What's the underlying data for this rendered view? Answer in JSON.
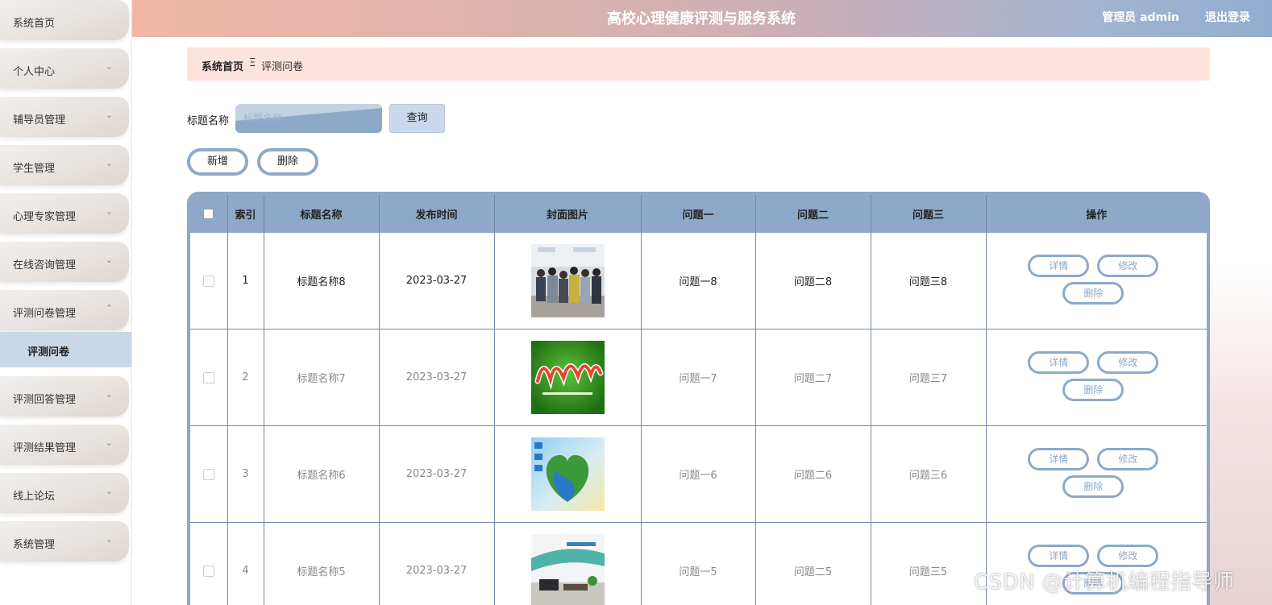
{
  "header": {
    "title": "高校心理健康评测与服务系统",
    "user": "管理员 admin",
    "logout": "退出登录"
  },
  "sidebar": {
    "items": [
      {
        "label": "系统首页"
      },
      {
        "label": "个人中心"
      },
      {
        "label": "辅导员管理"
      },
      {
        "label": "学生管理"
      },
      {
        "label": "心理专家管理"
      },
      {
        "label": "在线咨询管理"
      },
      {
        "label": "评测问卷管理"
      },
      {
        "label": "评测回答管理"
      },
      {
        "label": "评测结果管理"
      },
      {
        "label": "线上论坛"
      },
      {
        "label": "系统管理"
      }
    ],
    "submenu": {
      "label": "评测问卷"
    },
    "chevron_down": "⌄",
    "chevron_up": "⌃"
  },
  "breadcrumb": {
    "home": "系统首页",
    "sep": "Ξ",
    "current": "评测问卷"
  },
  "search": {
    "label": "标题名称",
    "placeholder": "标题名称",
    "query_button": "查询"
  },
  "actions": {
    "add": "新增",
    "delete": "删除"
  },
  "table": {
    "columns": [
      "索引",
      "标题名称",
      "发布时间",
      "封面图片",
      "问题一",
      "问题二",
      "问题三",
      "操作"
    ],
    "rows": [
      {
        "index": "1",
        "title": "标题名称8",
        "date": "2023-03-27",
        "q1": "问题一8",
        "q2": "问题二8",
        "q3": "问题三8"
      },
      {
        "index": "2",
        "title": "标题名称7",
        "date": "2023-03-27",
        "q1": "问题一7",
        "q2": "问题二7",
        "q3": "问题三7"
      },
      {
        "index": "3",
        "title": "标题名称6",
        "date": "2023-03-27",
        "q1": "问题一6",
        "q2": "问题二6",
        "q3": "问题三6"
      },
      {
        "index": "4",
        "title": "标题名称5",
        "date": "2023-03-27",
        "q1": "问题一5",
        "q2": "问题二5",
        "q3": "问题三5"
      }
    ],
    "ops": {
      "detail": "详情",
      "edit": "修改",
      "delete": "删除"
    }
  },
  "watermark": "CSDN @计算机编程指导师",
  "colors": {
    "accent": "#8ea9c8",
    "breadcrumb_bg": "#fde3dc",
    "submenu_bg": "#c9d8e8"
  }
}
